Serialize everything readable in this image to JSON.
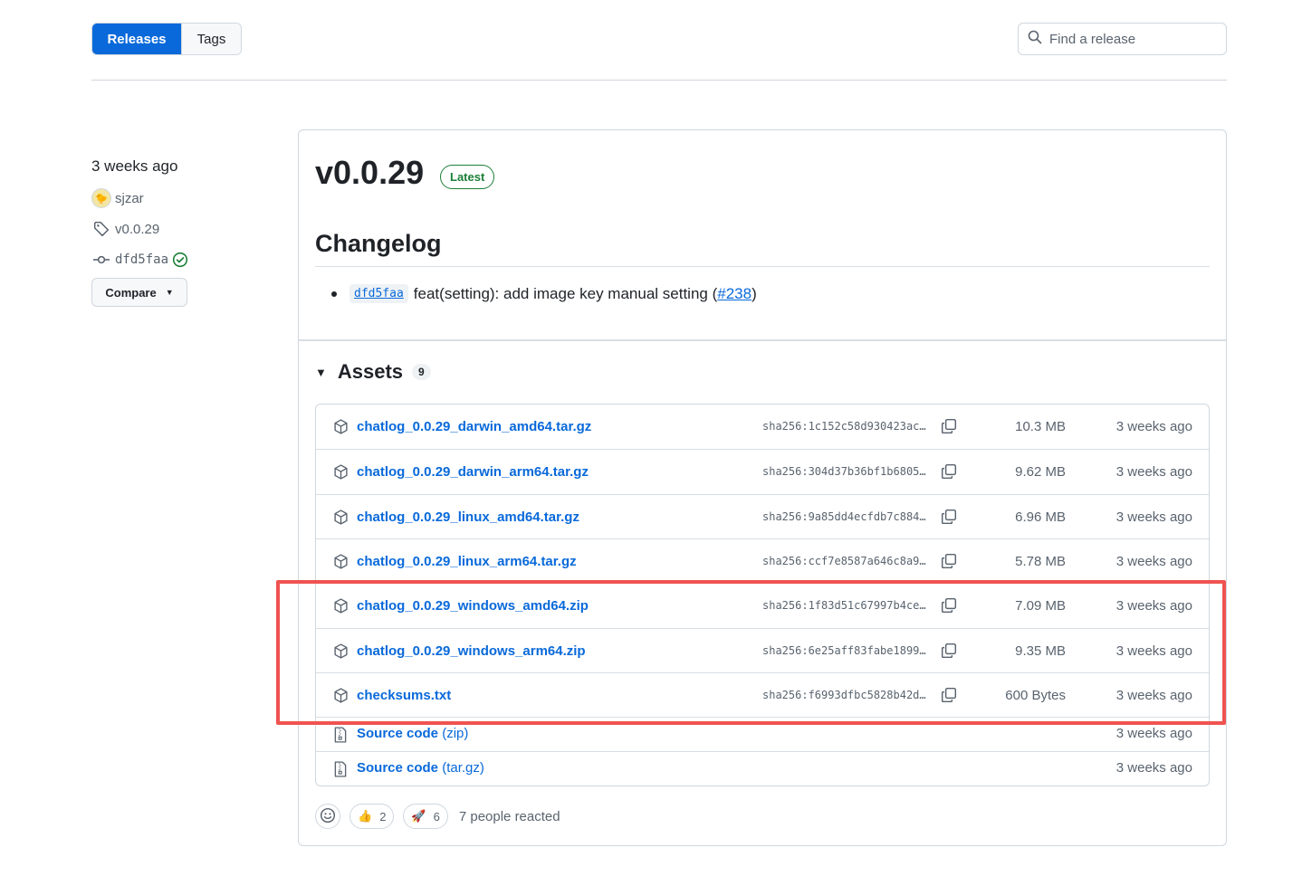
{
  "tabs": {
    "releases": "Releases",
    "tags": "Tags"
  },
  "search": {
    "placeholder": "Find a release",
    "icon": "search-icon"
  },
  "sidebar": {
    "date": "3 weeks ago",
    "author": "sjzar",
    "tag": "v0.0.29",
    "commit": "dfd5faa",
    "compare_label": "Compare"
  },
  "release": {
    "version": "v0.0.29",
    "badge": "Latest",
    "changelog_heading": "Changelog",
    "changelog_items": [
      {
        "commit": "dfd5faa",
        "text_before": "feat(setting): add image key manual setting (",
        "link": "#238",
        "text_after": ")"
      }
    ]
  },
  "assets": {
    "heading": "Assets",
    "count": "9",
    "files": [
      {
        "name": "chatlog_0.0.29_darwin_amd64.tar.gz",
        "sha": "sha256:1c152c58d930423ac…",
        "size": "10.3 MB",
        "date": "3 weeks ago"
      },
      {
        "name": "chatlog_0.0.29_darwin_arm64.tar.gz",
        "sha": "sha256:304d37b36bf1b6805…",
        "size": "9.62 MB",
        "date": "3 weeks ago"
      },
      {
        "name": "chatlog_0.0.29_linux_amd64.tar.gz",
        "sha": "sha256:9a85dd4ecfdb7c884…",
        "size": "6.96 MB",
        "date": "3 weeks ago"
      },
      {
        "name": "chatlog_0.0.29_linux_arm64.tar.gz",
        "sha": "sha256:ccf7e8587a646c8a9…",
        "size": "5.78 MB",
        "date": "3 weeks ago"
      },
      {
        "name": "chatlog_0.0.29_windows_amd64.zip",
        "sha": "sha256:1f83d51c67997b4ce…",
        "size": "7.09 MB",
        "date": "3 weeks ago"
      },
      {
        "name": "chatlog_0.0.29_windows_arm64.zip",
        "sha": "sha256:6e25aff83fabe1899…",
        "size": "9.35 MB",
        "date": "3 weeks ago"
      },
      {
        "name": "checksums.txt",
        "sha": "sha256:f6993dfbc5828b42d…",
        "size": "600 Bytes",
        "date": "3 weeks ago"
      }
    ],
    "source": [
      {
        "name": "Source code",
        "format": "(zip)",
        "date": "3 weeks ago"
      },
      {
        "name": "Source code",
        "format": "(tar.gz)",
        "date": "3 weeks ago"
      }
    ]
  },
  "reactions": {
    "thumbs_up_count": "2",
    "rocket_count": "6",
    "summary": "7 people reacted"
  },
  "colors": {
    "accent": "#0969da",
    "success": "#1a7f37",
    "highlight": "#ef5350"
  }
}
